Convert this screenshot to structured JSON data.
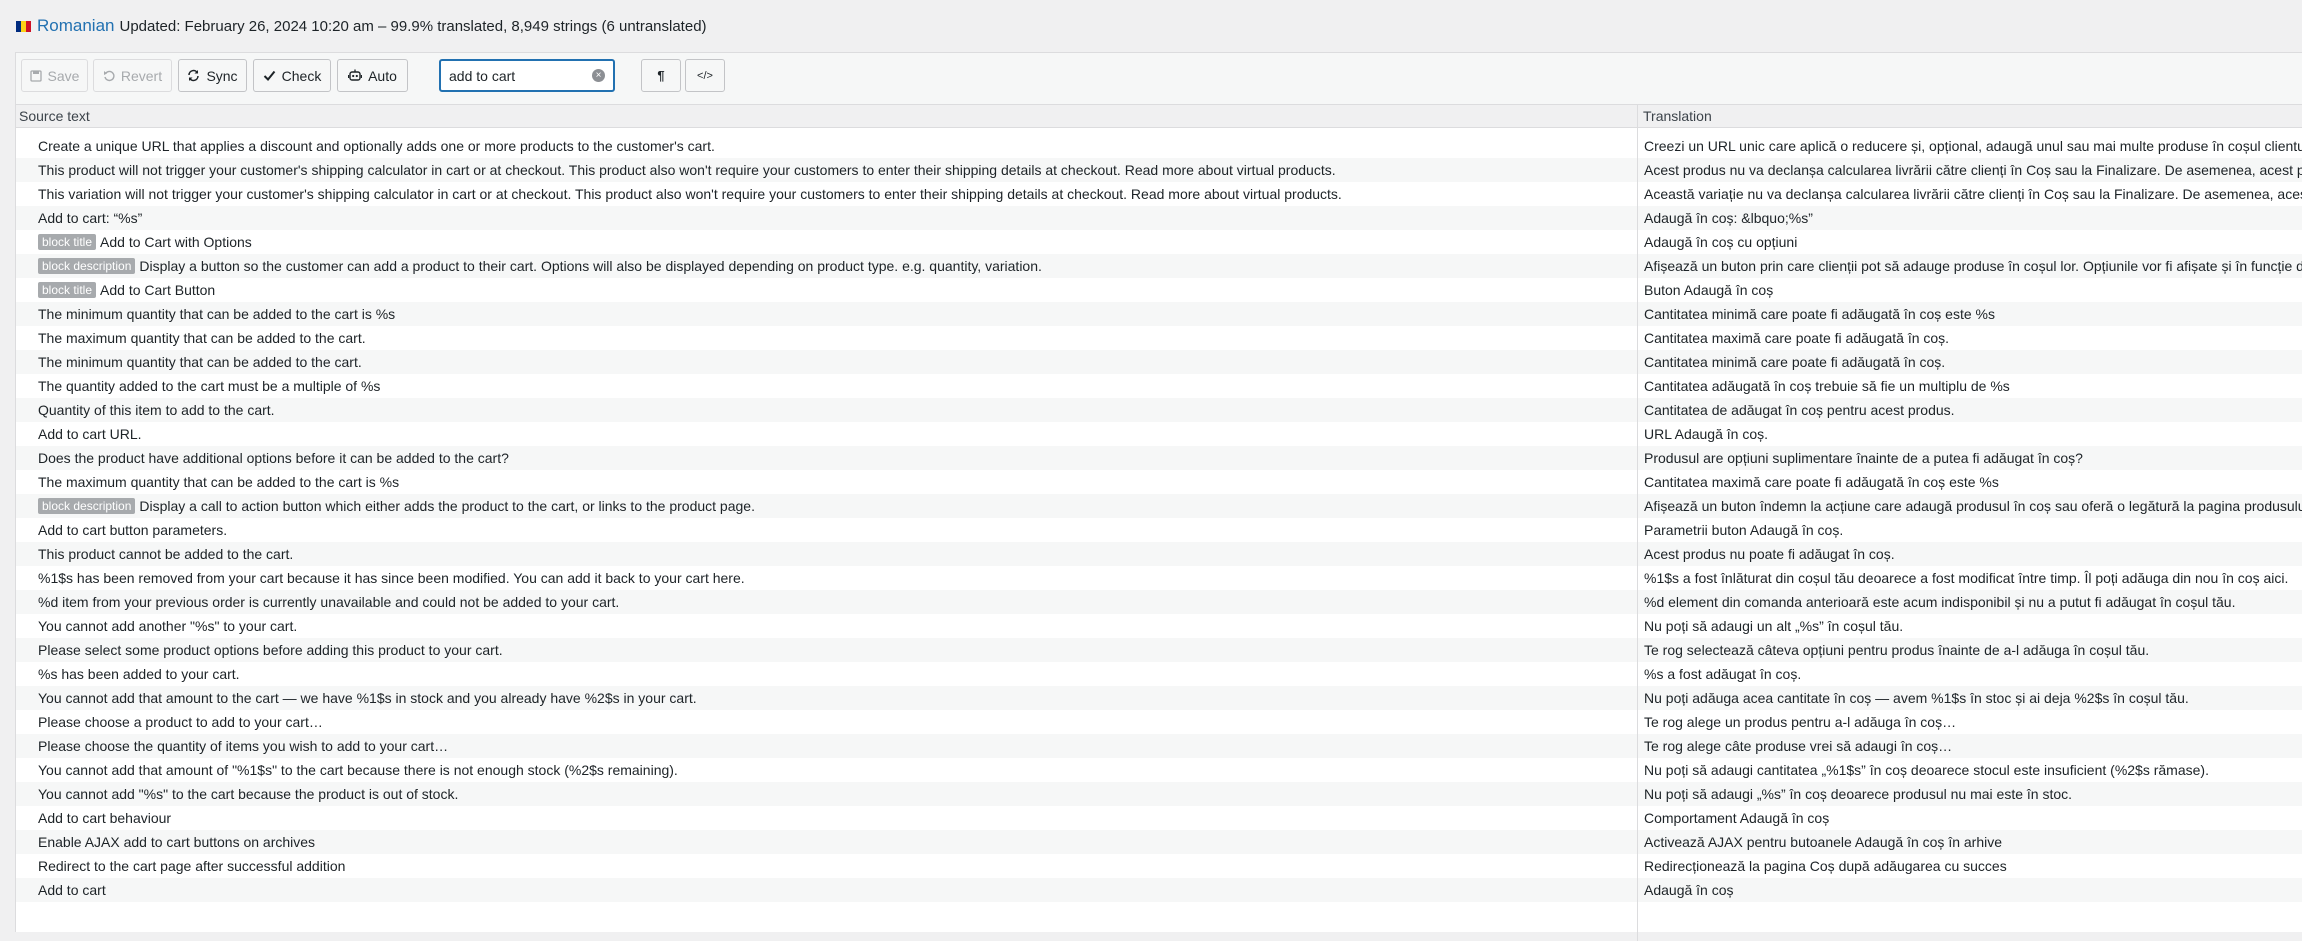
{
  "header": {
    "flag_colors": [
      "#002B7F",
      "#FCD116",
      "#CE1126"
    ],
    "language": "Romanian",
    "status": "Updated: February 26, 2024 10:20 am – 99.9% translated, 8,949 strings (6 untranslated)"
  },
  "toolbar": {
    "save": "Save",
    "revert": "Revert",
    "sync": "Sync",
    "check": "Check",
    "auto": "Auto",
    "search_value": "add to cart",
    "pilcrow": "¶",
    "code": "</>"
  },
  "columns": {
    "source": "Source text",
    "translation": "Translation"
  },
  "rows": [
    {
      "tag": "",
      "src": "Create a unique URL that applies a discount and optionally adds one or more products to the customer's cart.",
      "tr": "Creezi un URL unic care aplică o reducere și, opțional, adaugă unul sau mai multe produse în coșul clientului."
    },
    {
      "tag": "",
      "src": "This product will not trigger your customer's shipping calculator in cart or at checkout. This product also won't require your customers to enter their shipping details at checkout. Read more about virtual products.",
      "tr": "Acest produs nu va declanșa calcularea livrării către clienți în Coș sau la Finalizare. De asemenea, acest produs nu va cere clienților să introducă detaliile de livrare."
    },
    {
      "tag": "",
      "src": "This variation will not trigger your customer's shipping calculator in cart or at checkout. This product also won't require your customers to enter their shipping details at checkout. Read more about virtual products.",
      "tr": "Această variație nu va declanșa calcularea livrării către clienți în Coș sau la Finalizare. De asemenea, acest produs nu va cere clienților să introducă detaliile de livrare."
    },
    {
      "tag": "",
      "src": "Add to cart: “%s”",
      "tr": "Adaugă în coș: &lbquo;%s”"
    },
    {
      "tag": "block title",
      "src": "Add to Cart with Options",
      "tr": "Adaugă în coș cu opțiuni"
    },
    {
      "tag": "block description",
      "src": "Display a button so the customer can add a product to their cart. Options will also be displayed depending on product type. e.g. quantity, variation.",
      "tr": "Afișează un buton prin care clienții pot să adauge produse în coșul lor. Opțiunile vor fi afișate și în funcție de tipul produsului."
    },
    {
      "tag": "block title",
      "src": "Add to Cart Button",
      "tr": "Buton Adaugă în coș"
    },
    {
      "tag": "",
      "src": "The minimum quantity that can be added to the cart is %s",
      "tr": "Cantitatea minimă care poate fi adăugată în coș este %s"
    },
    {
      "tag": "",
      "src": "The maximum quantity that can be added to the cart.",
      "tr": "Cantitatea maximă care poate fi adăugată în coș."
    },
    {
      "tag": "",
      "src": "The minimum quantity that can be added to the cart.",
      "tr": "Cantitatea minimă care poate fi adăugată în coș."
    },
    {
      "tag": "",
      "src": "The quantity added to the cart must be a multiple of %s",
      "tr": "Cantitatea adăugată în coș trebuie să fie un multiplu de %s"
    },
    {
      "tag": "",
      "src": "Quantity of this item to add to the cart.",
      "tr": "Cantitatea de adăugat în coș pentru acest produs."
    },
    {
      "tag": "",
      "src": "Add to cart URL.",
      "tr": "URL Adaugă în coș."
    },
    {
      "tag": "",
      "src": "Does the product have additional options before it can be added to the cart?",
      "tr": "Produsul are opțiuni suplimentare înainte de a putea fi adăugat în coș?"
    },
    {
      "tag": "",
      "src": "The maximum quantity that can be added to the cart is %s",
      "tr": "Cantitatea maximă care poate fi adăugată în coș este %s"
    },
    {
      "tag": "block description",
      "src": "Display a call to action button which either adds the product to the cart, or links to the product page.",
      "tr": "Afișează un buton îndemn la acțiune care adaugă produsul în coș sau oferă o legătură la pagina produsului."
    },
    {
      "tag": "",
      "src": "Add to cart button parameters.",
      "tr": "Parametrii buton Adaugă în coș."
    },
    {
      "tag": "",
      "src": "This product cannot be added to the cart.",
      "tr": "Acest produs nu poate fi adăugat în coș."
    },
    {
      "tag": "",
      "src": "%1$s has been removed from your cart because it has since been modified. You can add it back to your cart here.",
      "tr": "%1$s a fost înlăturat din coșul tău deoarece a fost modificat între timp. Îl poți adăuga din nou în coș aici."
    },
    {
      "tag": "",
      "src": "%d item from your previous order is currently unavailable and could not be added to your cart.",
      "tr": "%d element din comanda anterioară este acum indisponibil și nu a putut fi adăugat în coșul tău."
    },
    {
      "tag": "",
      "src": "You cannot add another \"%s\" to your cart.",
      "tr": "Nu poți să adaugi un alt „%s” în coșul tău."
    },
    {
      "tag": "",
      "src": "Please select some product options before adding this product to your cart.",
      "tr": "Te rog selectează câteva opțiuni pentru produs înainte de a-l adăuga în coșul tău."
    },
    {
      "tag": "",
      "src": "%s has been added to your cart.",
      "tr": "%s a fost adăugat în coș."
    },
    {
      "tag": "",
      "src": "You cannot add that amount to the cart — we have %1$s in stock and you already have %2$s in your cart.",
      "tr": "Nu poți adăuga acea cantitate în coș — avem %1$s în stoc și ai deja %2$s în coșul tău."
    },
    {
      "tag": "",
      "src": "Please choose a product to add to your cart…",
      "tr": "Te rog alege un produs pentru a-l adăuga în coș…"
    },
    {
      "tag": "",
      "src": "Please choose the quantity of items you wish to add to your cart…",
      "tr": "Te rog alege câte produse vrei să adaugi în coș…"
    },
    {
      "tag": "",
      "src": "You cannot add that amount of \"%1$s\" to the cart because there is not enough stock (%2$s remaining).",
      "tr": "Nu poți să adaugi cantitatea „%1$s” în coș deoarece stocul este insuficient (%2$s rămase)."
    },
    {
      "tag": "",
      "src": "You cannot add \"%s\" to the cart because the product is out of stock.",
      "tr": "Nu poți să adaugi „%s” în coș deoarece produsul nu mai este în stoc."
    },
    {
      "tag": "",
      "src": "Add to cart behaviour",
      "tr": "Comportament Adaugă în coș"
    },
    {
      "tag": "",
      "src": "Enable AJAX add to cart buttons on archives",
      "tr": "Activează AJAX pentru butoanele Adaugă în coș în arhive"
    },
    {
      "tag": "",
      "src": "Redirect to the cart page after successful addition",
      "tr": "Redirecționează la pagina Coș după adăugarea cu succes"
    },
    {
      "tag": "",
      "src": "Add to cart",
      "tr": "Adaugă în coș"
    }
  ]
}
